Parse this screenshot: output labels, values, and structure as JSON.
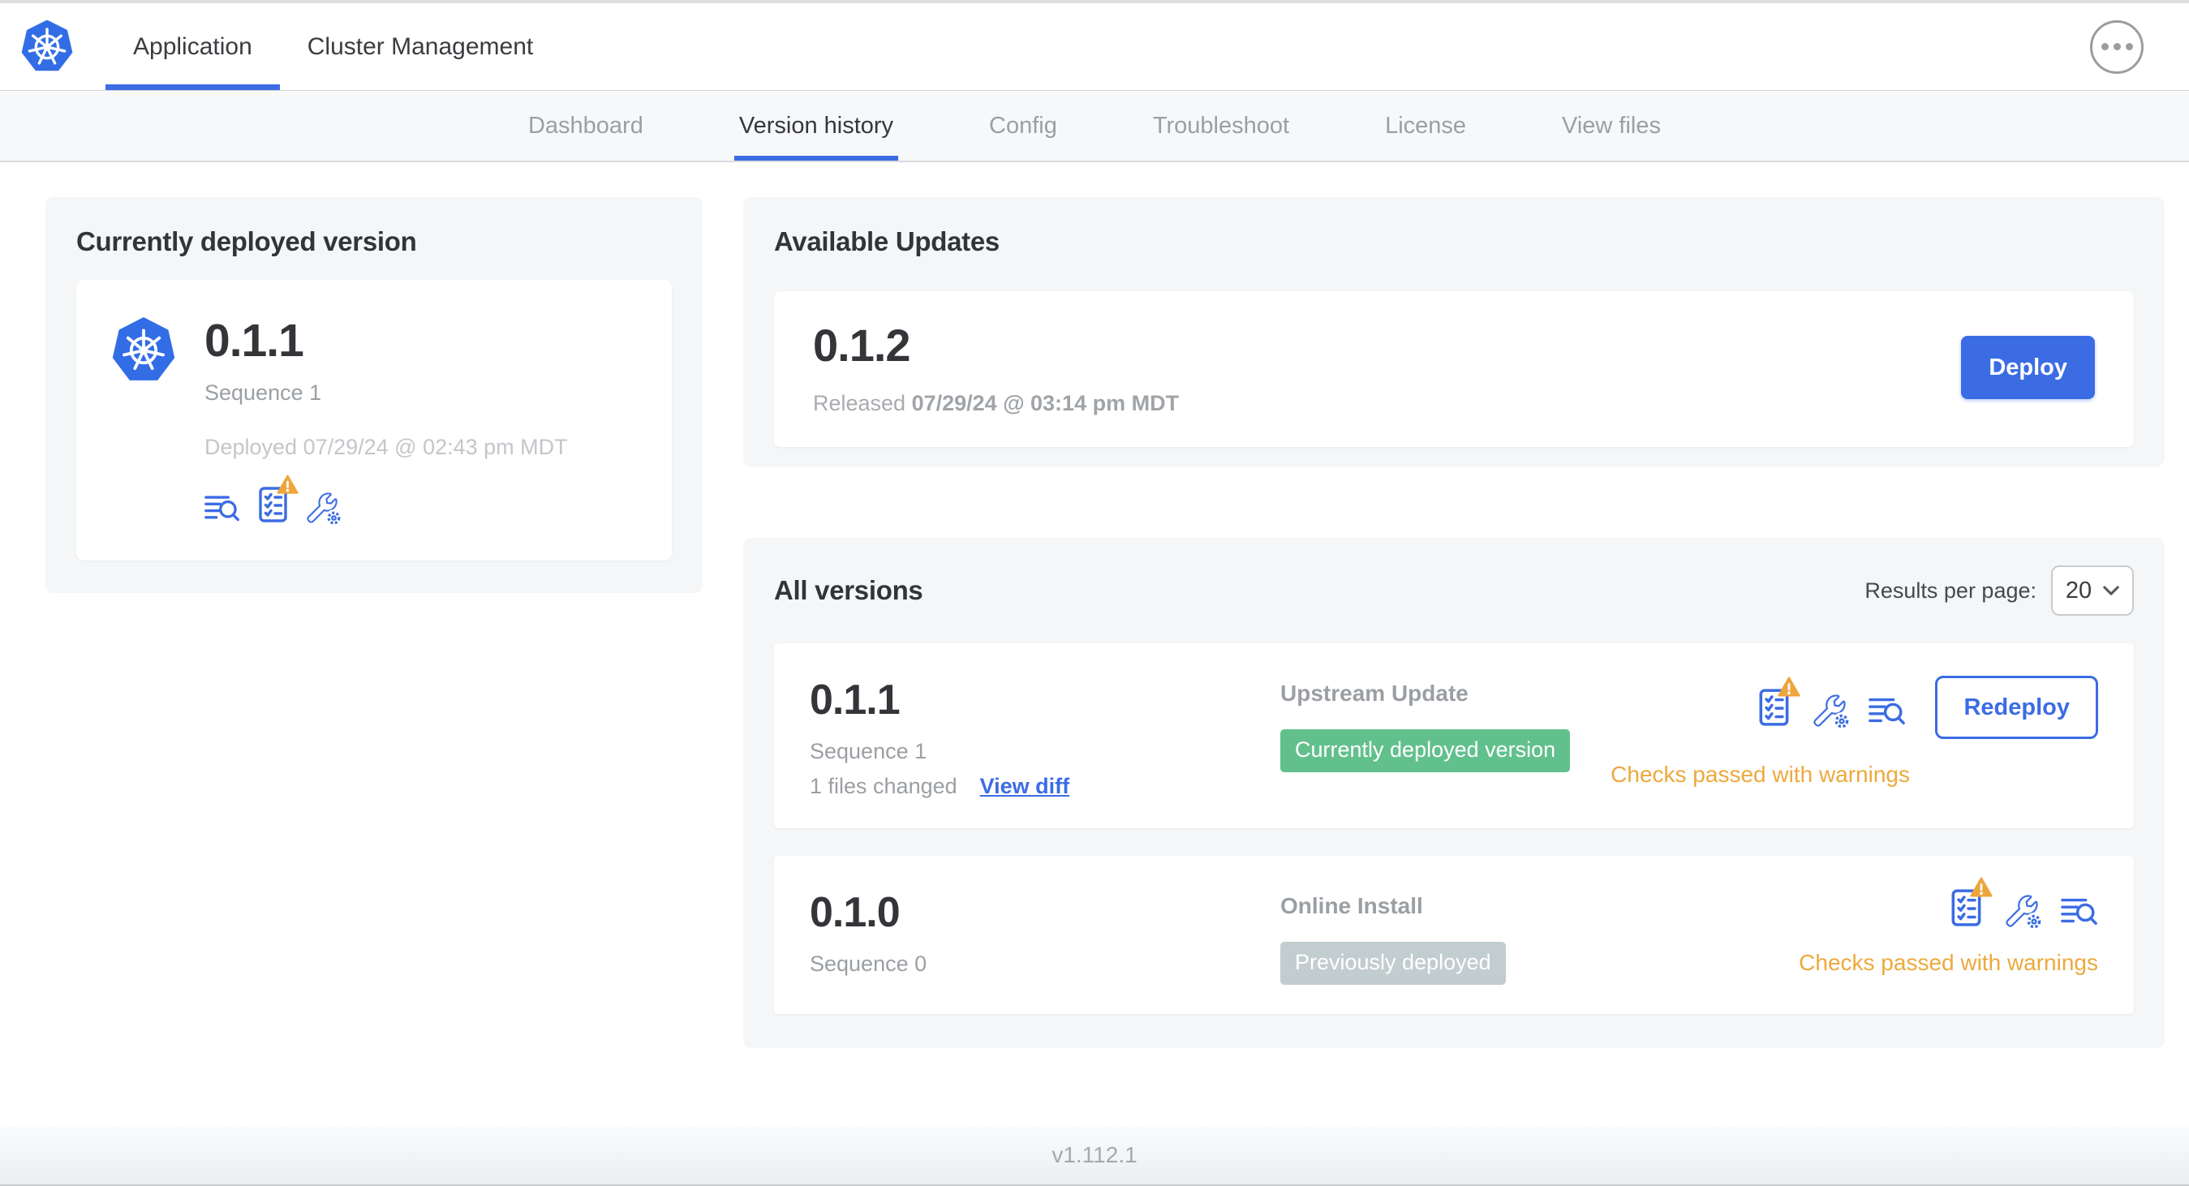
{
  "header": {
    "tabs": [
      {
        "label": "Application"
      },
      {
        "label": "Cluster Management"
      }
    ]
  },
  "nav": {
    "tabs": [
      {
        "label": "Dashboard"
      },
      {
        "label": "Version history"
      },
      {
        "label": "Config"
      },
      {
        "label": "Troubleshoot"
      },
      {
        "label": "License"
      },
      {
        "label": "View files"
      }
    ]
  },
  "current": {
    "title": "Currently deployed version",
    "version": "0.1.1",
    "sequence": "Sequence 1",
    "deployed": "Deployed 07/29/24 @ 02:43 pm MDT"
  },
  "updates": {
    "title": "Available Updates",
    "version": "0.1.2",
    "released_label": "Released",
    "released_date": "07/29/24 @ 03:14 pm MDT",
    "deploy_label": "Deploy"
  },
  "versions": {
    "title": "All versions",
    "results_label": "Results per page:",
    "results_value": "20",
    "rows": [
      {
        "version": "0.1.1",
        "sequence": "Sequence 1",
        "files_changed": "1 files changed",
        "view_diff_label": "View diff",
        "source": "Upstream Update",
        "badge": "Currently deployed version",
        "checks": "Checks passed with warnings",
        "redeploy_label": "Redeploy"
      },
      {
        "version": "0.1.0",
        "sequence": "Sequence 0",
        "source": "Online Install",
        "badge": "Previously deployed",
        "checks": "Checks passed with warnings"
      }
    ]
  },
  "footer": {
    "app_version": "v1.112.1"
  },
  "colors": {
    "accent_blue": "#3b6ce4",
    "k8s_blue": "#326de6",
    "green_badge": "#62c08d",
    "gray_badge": "#c2cdd0",
    "warning_orange": "#eda93c"
  }
}
